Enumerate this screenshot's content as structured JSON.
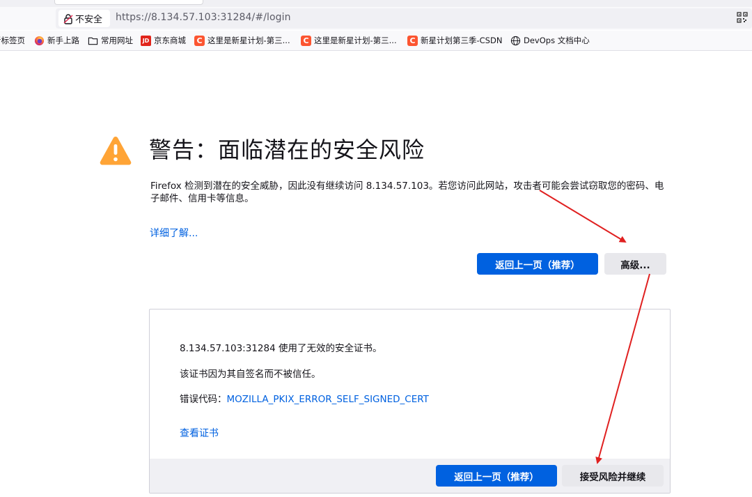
{
  "browser": {
    "identity_label": "不安全",
    "url": "https://8.134.57.103:31284/#/login"
  },
  "bookmarks": [
    {
      "label": "新标签页",
      "icon": "new-tab-icon"
    },
    {
      "label": "新手上路",
      "icon": "firefox-icon"
    },
    {
      "label": "常用网址",
      "icon": "folder-icon"
    },
    {
      "label": "京东商城",
      "icon": "jd-icon",
      "icon_text": "JD"
    },
    {
      "label": "这里是新星计划-第三...",
      "icon": "csdn-icon",
      "icon_text": "C"
    },
    {
      "label": "这里是新星计划-第三...",
      "icon": "csdn-icon",
      "icon_text": "C"
    },
    {
      "label": "新星计划第三季-CSDN",
      "icon": "csdn-icon",
      "icon_text": "C"
    },
    {
      "label": "DevOps 文档中心",
      "icon": "globe-icon"
    }
  ],
  "error_page": {
    "title": "警告：面临潜在的安全风险",
    "description": "Firefox 检测到潜在的安全威胁，因此没有继续访问 8.134.57.103。若您访问此网站，攻击者可能会尝试窃取您的密码、电子邮件、信用卡等信息。",
    "learn_more": "详细了解...",
    "go_back_button": "返回上一页（推荐）",
    "advanced_button": "高级...",
    "advanced": {
      "line1": "8.134.57.103:31284 使用了无效的安全证书。",
      "line2": "该证书因为其自签名而不被信任。",
      "error_code_label": "错误代码：",
      "error_code": "MOZILLA_PKIX_ERROR_SELF_SIGNED_CERT",
      "view_certificate": "查看证书",
      "go_back_button": "返回上一页（推荐）",
      "accept_button": "接受风险并继续"
    }
  },
  "colors": {
    "accent": "#0061e0",
    "warning": "#ffa436",
    "annotation_arrow": "#e02020"
  }
}
